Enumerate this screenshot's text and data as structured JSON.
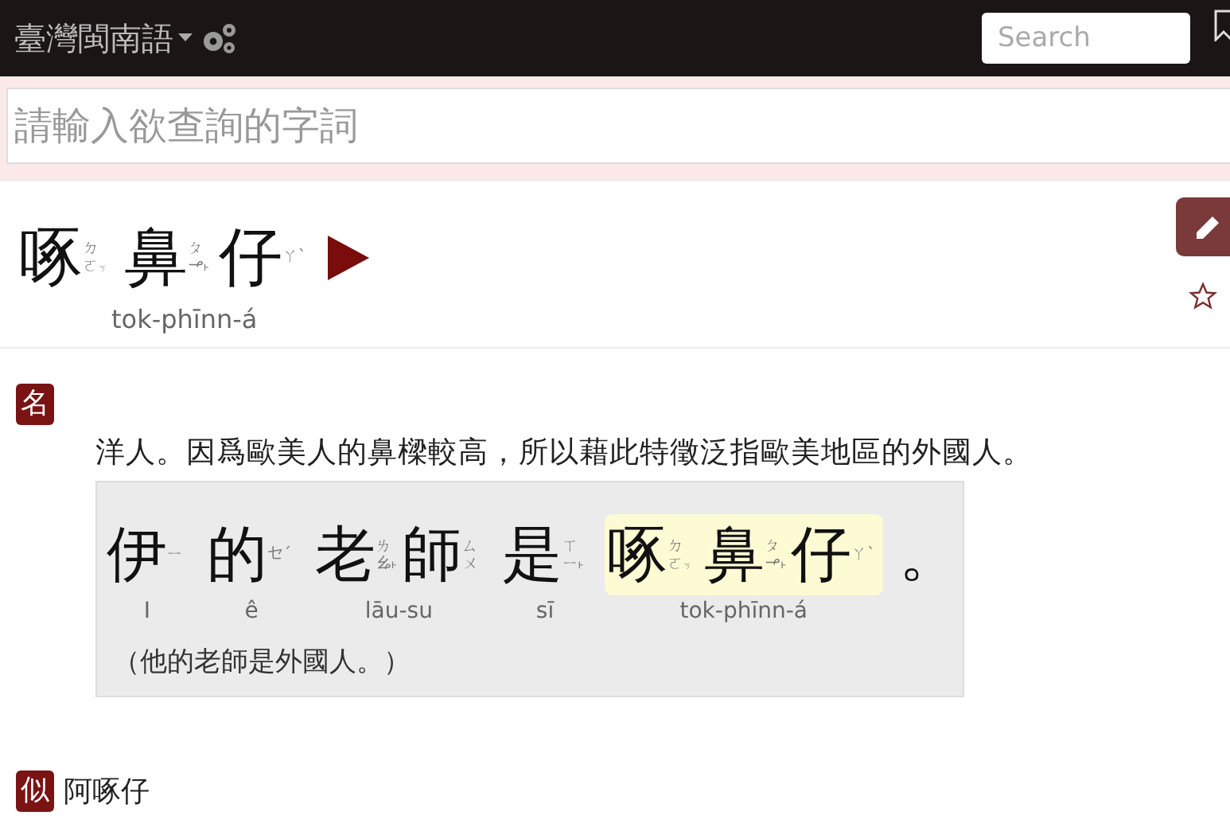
{
  "navbar": {
    "brand": "臺灣閩南語",
    "search": {
      "placeholder": "Search"
    }
  },
  "query": {
    "placeholder": "請輸入欲查詢的字詞"
  },
  "entry": {
    "title": [
      {
        "char": "啄",
        "zhuyin": "ㄉㄛ",
        "tone": "ㆶ"
      },
      {
        "char": "鼻",
        "zhuyin": "ㄆㆪ",
        "tone": "˫"
      },
      {
        "char": "仔",
        "zhuyin": "ㄚ",
        "tone": "ˋ"
      }
    ],
    "romanization": "tok-phīnn-á",
    "starred": false,
    "pos": "名",
    "definition": "洋人。因爲歐美人的鼻樑較高，所以藉此特徵泛指歐美地區的外國人。",
    "example": {
      "words": [
        {
          "highlighted": false,
          "romanization": "I",
          "chars": [
            {
              "char": "伊",
              "zhuyin": "ㄧ"
            }
          ]
        },
        {
          "highlighted": false,
          "romanization": "ê",
          "chars": [
            {
              "char": "的",
              "zhuyin": "ㆤ",
              "tone": "ˊ"
            }
          ]
        },
        {
          "highlighted": false,
          "romanization": "lāu-su",
          "chars": [
            {
              "char": "老",
              "zhuyin": "ㄌㆯ",
              "tone": "˫"
            },
            {
              "char": "師",
              "zhuyin": "ㄙㄨ"
            }
          ]
        },
        {
          "highlighted": false,
          "romanization": "sī",
          "chars": [
            {
              "char": "是",
              "zhuyin": "ㄒㄧ",
              "tone": "˫"
            }
          ]
        },
        {
          "highlighted": true,
          "romanization": "tok-phīnn-á",
          "chars": [
            {
              "char": "啄",
              "zhuyin": "ㄉㄛ",
              "tone": "ㆶ"
            },
            {
              "char": "鼻",
              "zhuyin": "ㄆㆪ",
              "tone": "˫"
            },
            {
              "char": "仔",
              "zhuyin": "ㄚ",
              "tone": "ˋ"
            }
          ]
        },
        {
          "highlighted": false,
          "chars": [
            {
              "char": "。"
            }
          ]
        }
      ],
      "translation": "（他的老師是外國人。）"
    },
    "synonym": {
      "label": "似",
      "text": "阿啄仔"
    }
  }
}
